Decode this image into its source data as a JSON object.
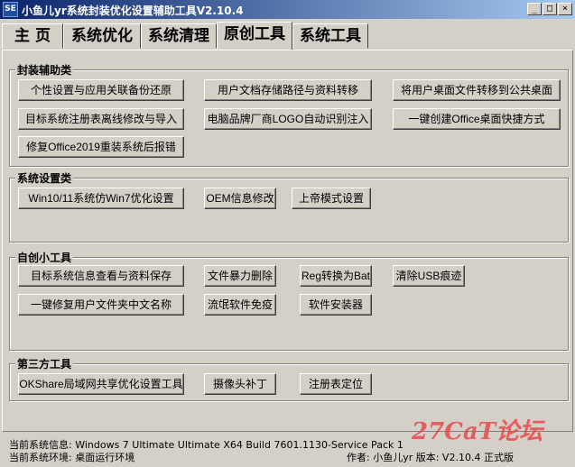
{
  "window": {
    "icon_text": "SE",
    "title": "小鱼儿yr系统封装优化设置辅助工具V2.10.4",
    "minimize_glyph": "_",
    "maximize_glyph": "□",
    "close_glyph": "×"
  },
  "tabs": [
    {
      "label": "主 页"
    },
    {
      "label": "系统优化"
    },
    {
      "label": "系统清理"
    },
    {
      "label": "原创工具",
      "active": true
    },
    {
      "label": "系统工具"
    }
  ],
  "groups": {
    "packaging": {
      "title": "封装辅助类",
      "buttons": [
        "个性设置与应用关联备份还原",
        "用户文档存储路径与资料转移",
        "将用户桌面文件转移到公共桌面",
        "目标系统注册表离线修改与导入",
        "电脑品牌厂商LOGO自动识别注入",
        "一键创建Office桌面快捷方式",
        "修复Office2019重装系统后报错"
      ]
    },
    "system_settings": {
      "title": "系统设置类",
      "buttons": [
        "Win10/11系统仿Win7优化设置",
        "OEM信息修改",
        "上帝模式设置"
      ]
    },
    "custom_tools": {
      "title": "自创小工具",
      "buttons": [
        "目标系统信息查看与资料保存",
        "文件暴力删除",
        "Reg转换为Bat",
        "清除USB痕迹",
        "一键修复用户文件夹中文名称",
        "流氓软件免疫",
        "软件安装器"
      ]
    },
    "third_party": {
      "title": "第三方工具",
      "buttons": [
        "OKShare局域网共享优化设置工具",
        "摄像头补丁",
        "注册表定位"
      ]
    }
  },
  "status": {
    "system_info": "当前系统信息: Windows 7 Ultimate Ultimate X64 Build 7601.1130-Service Pack 1",
    "environment": "当前系统环境: 桌面运行环境",
    "author": "作者: 小鱼儿yr    版本: V2.10.4 正式版"
  },
  "watermark": "27CaT论坛"
}
